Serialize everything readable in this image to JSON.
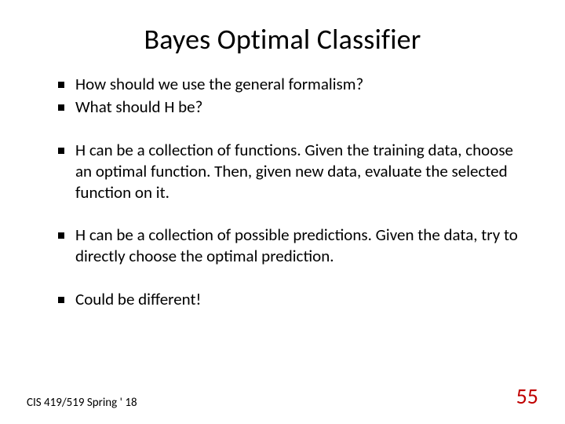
{
  "title": "Bayes Optimal Classifier",
  "bullets": {
    "b0": "How should we use the general formalism?",
    "b1": "What should H be?",
    "b2": "H can be a collection of functions. Given the training data, choose an optimal function. Then, given new data, evaluate the selected function on it.",
    "b3": "H can be a collection of possible predictions. Given the data, try to directly choose the optimal prediction.",
    "b4": "Could be different!"
  },
  "footer": {
    "course": "CIS 419/519 Spring ' 18",
    "page": "55"
  }
}
